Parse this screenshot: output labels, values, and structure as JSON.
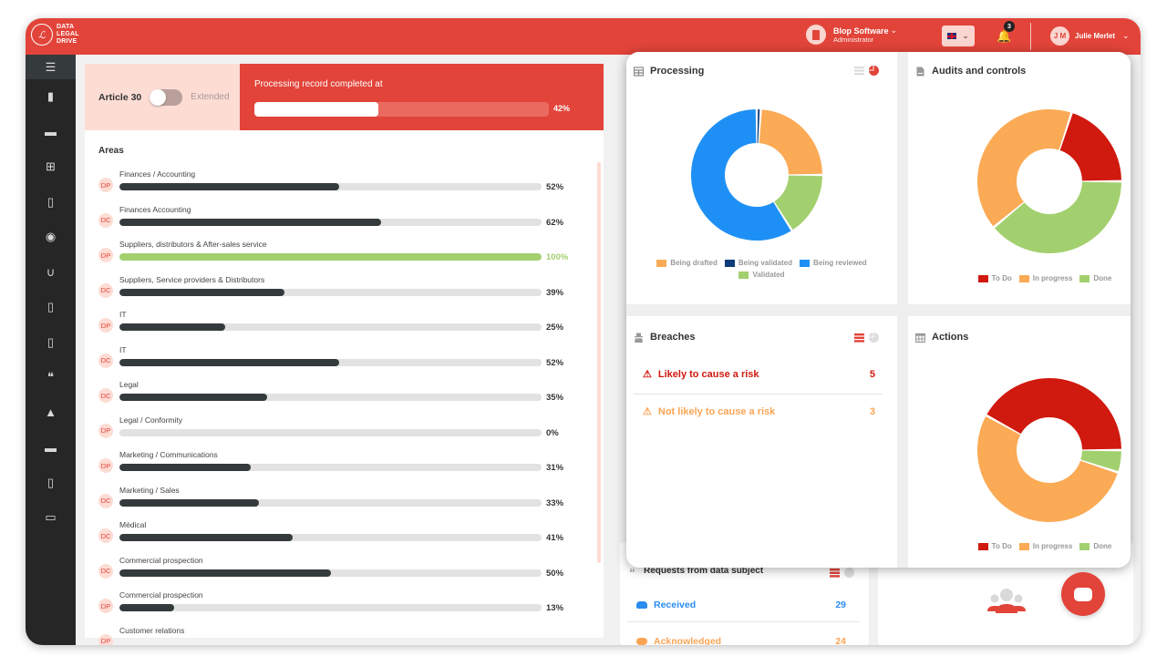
{
  "app": {
    "logo_text": [
      "DATA",
      "LEGAL",
      "DRIVE"
    ],
    "brand_color": "#e2443a"
  },
  "header": {
    "org_name": "Blop Software",
    "org_role": "Administrator",
    "language": "en-GB",
    "notification_count": "3",
    "user_initials": "J M",
    "user_name": "Julie Merlet"
  },
  "sidebar": {
    "items": [
      {
        "icon": "menu-collapse-icon"
      },
      {
        "icon": "building-icon"
      },
      {
        "icon": "calendar-icon"
      },
      {
        "icon": "table-icon"
      },
      {
        "icon": "document-icon"
      },
      {
        "icon": "disc-icon"
      },
      {
        "icon": "stethoscope-icon"
      },
      {
        "icon": "zip-file-icon"
      },
      {
        "icon": "file-signature-icon"
      },
      {
        "icon": "quote-icon"
      },
      {
        "icon": "user-secret-icon"
      },
      {
        "icon": "book-icon"
      },
      {
        "icon": "clipboard-icon"
      },
      {
        "icon": "id-card-icon"
      }
    ]
  },
  "summary": {
    "article_label": "Article 30",
    "extended_label": "Extended",
    "toggle_on": false,
    "progress_title": "Processing record completed at",
    "progress_value": 42,
    "progress_label": "42%"
  },
  "areas": {
    "title": "Areas",
    "items": [
      {
        "badge": "DP",
        "name": "Finances / Accounting",
        "value": 52,
        "label": "52%"
      },
      {
        "badge": "DC",
        "name": "Finances Accounting",
        "value": 62,
        "label": "62%"
      },
      {
        "badge": "DP",
        "name": "Suppliers, distributors & After-sales service",
        "value": 100,
        "label": "100%"
      },
      {
        "badge": "DC",
        "name": "Suppliers, Service providers & Distributors",
        "value": 39,
        "label": "39%"
      },
      {
        "badge": "DP",
        "name": "IT",
        "value": 25,
        "label": "25%"
      },
      {
        "badge": "DC",
        "name": "IT",
        "value": 52,
        "label": "52%"
      },
      {
        "badge": "DC",
        "name": "Legal",
        "value": 35,
        "label": "35%"
      },
      {
        "badge": "DP",
        "name": "Legal / Conformity",
        "value": 0,
        "label": "0%"
      },
      {
        "badge": "DP",
        "name": "Marketing / Communications",
        "value": 31,
        "label": "31%"
      },
      {
        "badge": "DC",
        "name": "Marketing / Sales",
        "value": 33,
        "label": "33%"
      },
      {
        "badge": "DC",
        "name": "Médical",
        "value": 41,
        "label": "41%"
      },
      {
        "badge": "DC",
        "name": "Commercial prospection",
        "value": 50,
        "label": "50%"
      },
      {
        "badge": "DP",
        "name": "Commercial prospection",
        "value": 13,
        "label": "13%"
      },
      {
        "badge": "DP",
        "name": "Customer relations",
        "value": null,
        "label": ""
      }
    ]
  },
  "processing": {
    "title": "Processing",
    "legend": [
      {
        "label": "Being drafted",
        "color": "#fbaa55"
      },
      {
        "label": "Being validated",
        "color": "#0d3c7a"
      },
      {
        "label": "Being reviewed",
        "color": "#1e90f5"
      },
      {
        "label": "Validated",
        "color": "#a3d06f"
      }
    ]
  },
  "audits": {
    "title": "Audits and controls",
    "legend": [
      {
        "label": "To Do",
        "color": "#d0190f"
      },
      {
        "label": "In progress",
        "color": "#fbaa55"
      },
      {
        "label": "Done",
        "color": "#a3d06f"
      }
    ]
  },
  "breaches": {
    "title": "Breaches",
    "rows": [
      {
        "label": "Likely to cause a risk",
        "count": "5",
        "color": "#d0190f"
      },
      {
        "label": "Not likely to cause a risk",
        "count": "3",
        "color": "#fba455"
      }
    ]
  },
  "actions": {
    "title": "Actions",
    "legend": [
      {
        "label": "To Do",
        "color": "#d0190f"
      },
      {
        "label": "In progress",
        "color": "#fbaa55"
      },
      {
        "label": "Done",
        "color": "#a3d06f"
      }
    ]
  },
  "requests": {
    "title": "Requests from data subject",
    "rows": [
      {
        "label": "Received",
        "count": "29"
      },
      {
        "label": "Acknowledged",
        "count": "24"
      }
    ]
  },
  "chart_data": [
    {
      "type": "pie",
      "title": "Processing",
      "donut": true,
      "categories": [
        "Being validated",
        "Being drafted",
        "Validated",
        "Being reviewed"
      ],
      "values": [
        1,
        24,
        16,
        59
      ],
      "colors": [
        "#0d3c7a",
        "#fbaa55",
        "#a3d06f",
        "#1e90f5"
      ],
      "legend": "bottom"
    },
    {
      "type": "pie",
      "title": "Audits and controls",
      "donut": true,
      "categories": [
        "To Do",
        "Done",
        "In progress"
      ],
      "values": [
        20,
        39,
        41
      ],
      "start_offset": 0.05,
      "colors": [
        "#d0190f",
        "#a3d06f",
        "#fbaa55"
      ],
      "legend": "bottom"
    },
    {
      "type": "pie",
      "title": "Actions",
      "donut": true,
      "categories": [
        "To Do",
        "Done",
        "In progress"
      ],
      "values": [
        42,
        5,
        53
      ],
      "start_offset": -0.17,
      "colors": [
        "#d0190f",
        "#a3d06f",
        "#fbaa55"
      ],
      "legend": "bottom"
    }
  ]
}
